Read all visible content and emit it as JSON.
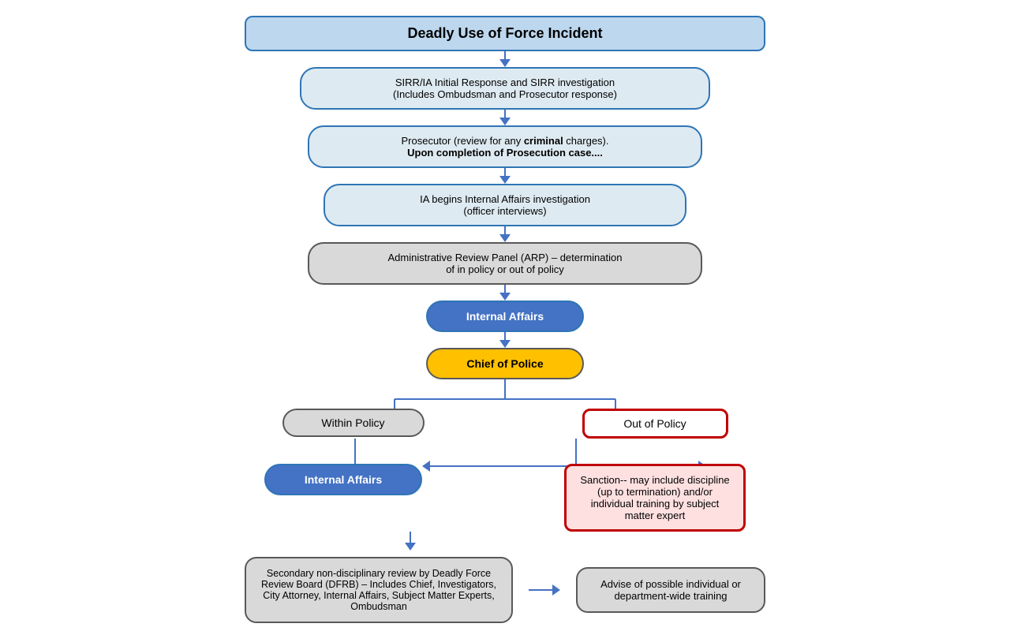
{
  "title": "Deadly Use of Force Incident",
  "boxes": {
    "box1": "SIRR/IA Initial Response and SIRR investigation\n(Includes Ombudsman and Prosecutor response)",
    "box2_line1": "Prosecutor (review for any ",
    "box2_bold": "criminal",
    "box2_line2": " charges).",
    "box2_line3": "Upon completion of Prosecution case....",
    "box3": "IA begins Internal Affairs investigation\n(officer interviews)",
    "box4_line1": "Administrative Review Panel (ARP) – determination",
    "box4_line2": "of in policy or out of policy",
    "box5": "Internal Affairs",
    "box6": "Chief of Police",
    "box7_within": "Within Policy",
    "box7_out": "Out of Policy",
    "box8_ia": "Internal Affairs",
    "box9_sanction": "Sanction-- may include discipline (up to termination) and/or individual training by subject matter expert",
    "box10_secondary": "Secondary non-disciplinary review by Deadly Force Review Board (DFRB) – Includes Chief, Investigators, City Attorney, Internal Affairs, Subject Matter Experts, Ombudsman",
    "box11_advise": "Advise of possible individual or department-wide training"
  }
}
